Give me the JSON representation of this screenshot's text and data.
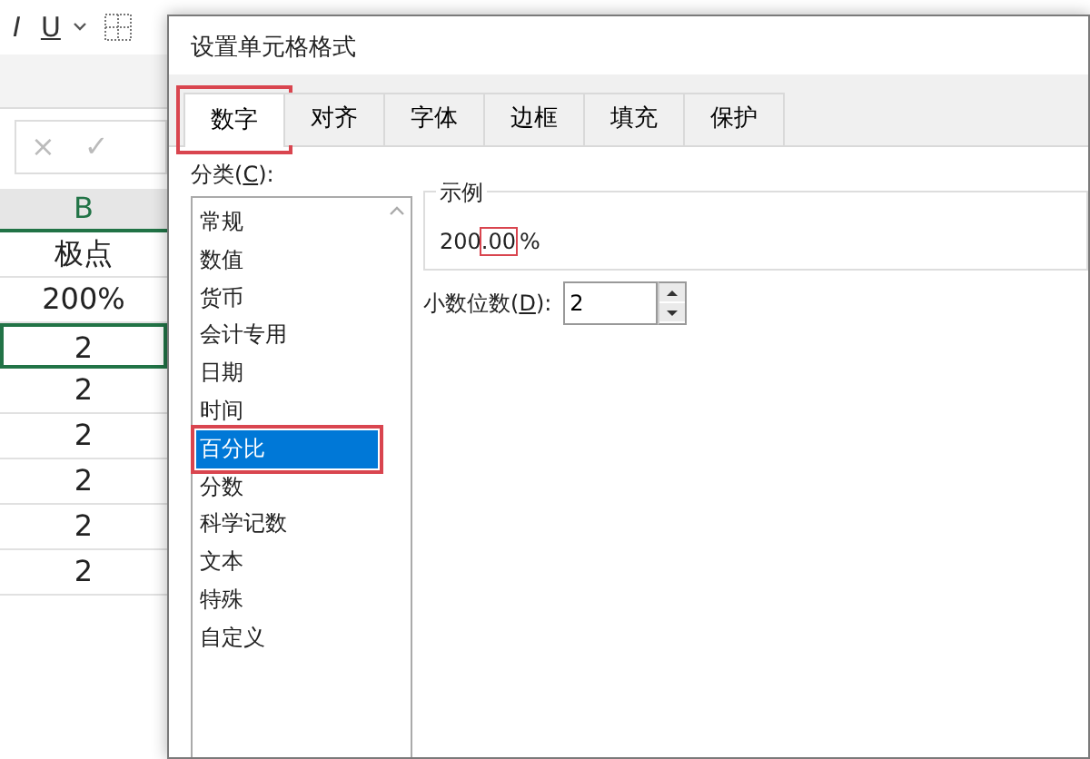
{
  "toolbar": {
    "buttons": [
      {
        "label": "I"
      },
      {
        "label": "U"
      }
    ]
  },
  "formula_bar": {
    "buttons": [
      {
        "label": "×",
        "disabled": true
      },
      {
        "label": "✓",
        "disabled": true
      }
    ]
  },
  "sheet": {
    "column": "B",
    "cells": [
      {
        "value": "极点",
        "selected": false
      },
      {
        "value": "200%",
        "selected": false
      },
      {
        "value": "2",
        "selected": true
      },
      {
        "value": "2",
        "selected": false
      },
      {
        "value": "2",
        "selected": false
      },
      {
        "value": "2",
        "selected": false
      },
      {
        "value": "2",
        "selected": false
      },
      {
        "value": "2",
        "selected": false
      }
    ]
  },
  "dialog": {
    "title": "设置单元格格式",
    "tabs": [
      {
        "label": "数字",
        "selected": true,
        "highlighted": true
      },
      {
        "label": "对齐",
        "selected": false,
        "highlighted": false
      },
      {
        "label": "字体",
        "selected": false,
        "highlighted": false
      },
      {
        "label": "边框",
        "selected": false,
        "highlighted": false
      },
      {
        "label": "填充",
        "selected": false,
        "highlighted": false
      },
      {
        "label": "保护",
        "selected": false,
        "highlighted": false
      }
    ],
    "category": {
      "label_before": "分类(",
      "access_key": "C",
      "label_after": "):",
      "items": [
        {
          "label": "常规",
          "selected": false,
          "highlighted": false
        },
        {
          "label": "数值",
          "selected": false,
          "highlighted": false
        },
        {
          "label": "货币",
          "selected": false,
          "highlighted": false
        },
        {
          "label": "会计专用",
          "selected": false,
          "highlighted": false
        },
        {
          "label": "日期",
          "selected": false,
          "highlighted": false
        },
        {
          "label": "时间",
          "selected": false,
          "highlighted": false
        },
        {
          "label": "百分比",
          "selected": true,
          "highlighted": true
        },
        {
          "label": "分数",
          "selected": false,
          "highlighted": false
        },
        {
          "label": "科学记数",
          "selected": false,
          "highlighted": false
        },
        {
          "label": "文本",
          "selected": false,
          "highlighted": false
        },
        {
          "label": "特殊",
          "selected": false,
          "highlighted": false
        },
        {
          "label": "自定义",
          "selected": false,
          "highlighted": false
        }
      ]
    },
    "sample": {
      "legend": "示例",
      "parts": [
        {
          "text": "200",
          "highlighted": false
        },
        {
          "text": ".00",
          "highlighted": true
        },
        {
          "text": "%",
          "highlighted": false
        }
      ]
    },
    "decimal_places": {
      "label_before": "小数位数(",
      "access_key": "D",
      "label_after": "):",
      "value": "2"
    }
  }
}
